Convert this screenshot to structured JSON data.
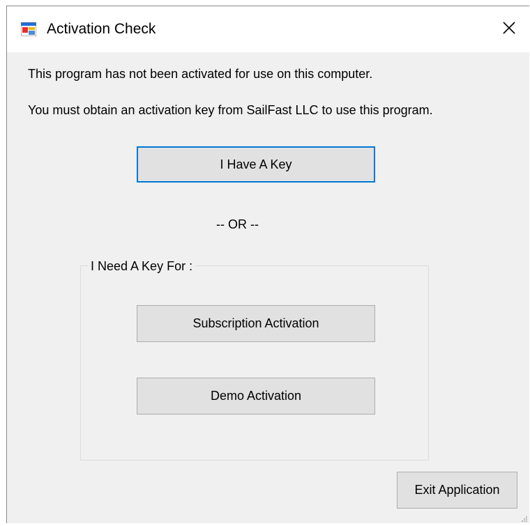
{
  "window": {
    "title": "Activation Check",
    "app_icon": "windows-form-icon",
    "close_icon": "close-icon"
  },
  "messages": {
    "line1": "This program has not been activated for use on this computer.",
    "line2": "You must obtain an activation key from SailFast LLC to use this program."
  },
  "buttons": {
    "have_key": "I Have A Key",
    "or_separator": "-- OR --",
    "subscription": "Subscription Activation",
    "demo": "Demo Activation",
    "exit": "Exit Application"
  },
  "group": {
    "legend": "I Need A Key For :"
  },
  "colors": {
    "window_bg": "#f0f0f0",
    "titlebar_bg": "#ffffff",
    "button_bg": "#e1e1e1",
    "button_border": "#adadad",
    "focus_border": "#0078d7"
  }
}
